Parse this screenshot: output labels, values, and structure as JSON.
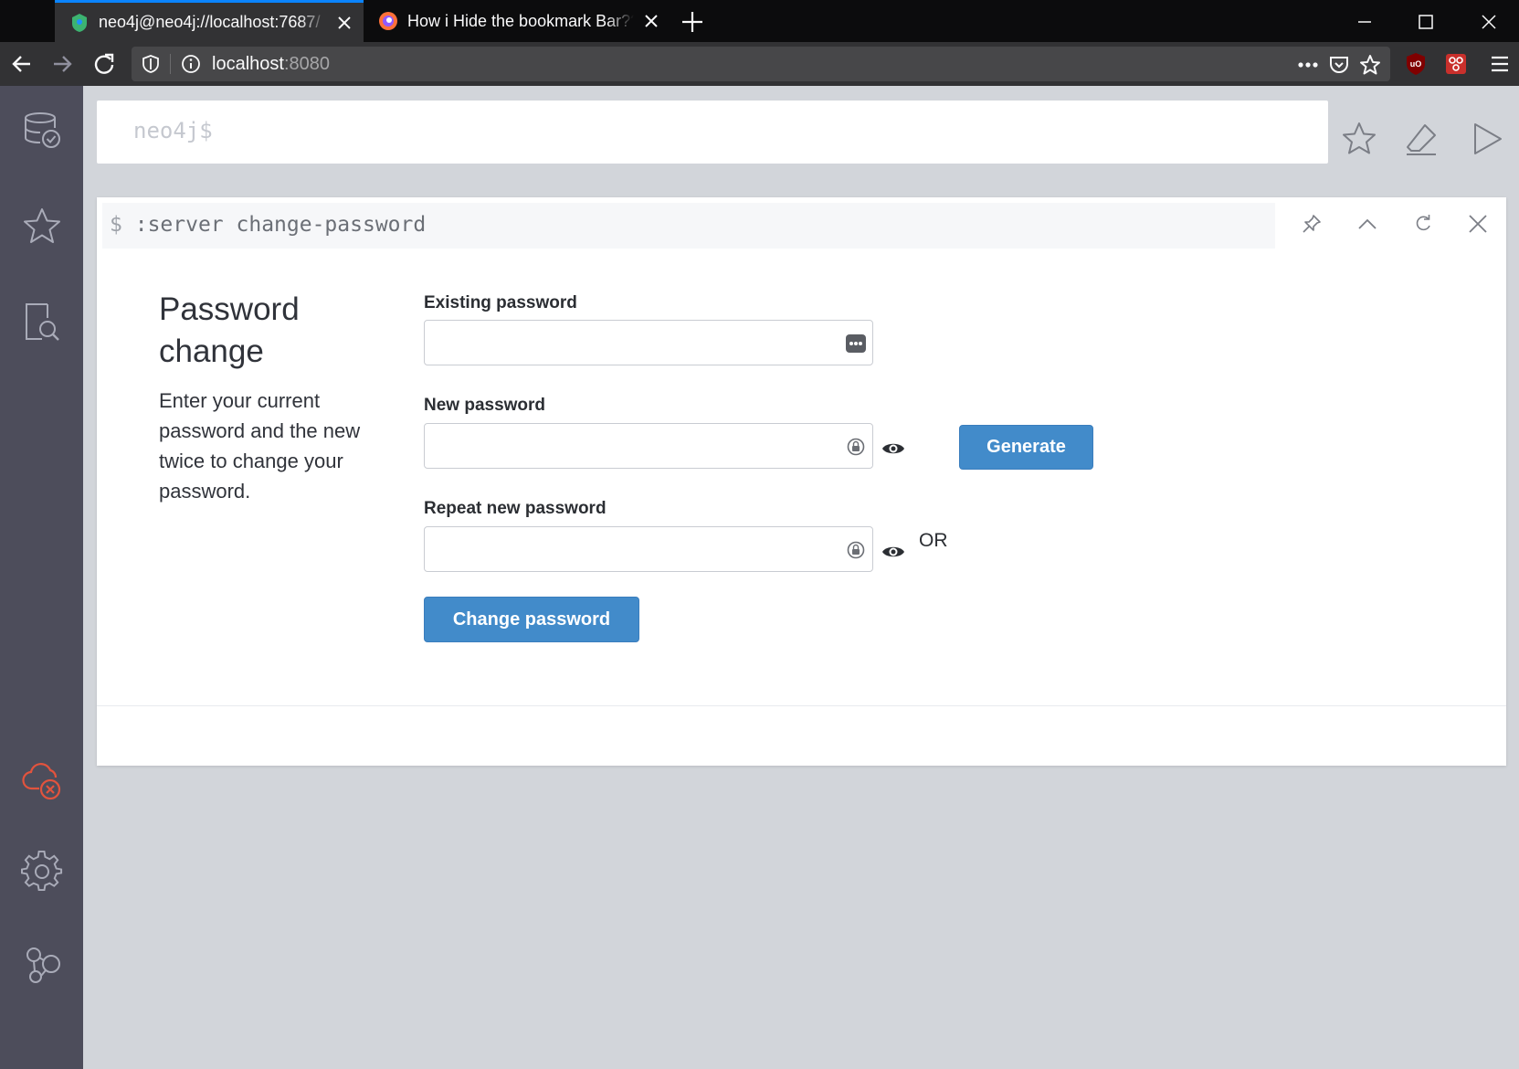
{
  "browser": {
    "tabs": [
      {
        "title": "neo4j@neo4j://localhost:7687/",
        "active": true,
        "favicon": "neo4j-icon"
      },
      {
        "title": "How i Hide the bookmark Bar??",
        "active": false,
        "favicon": "firefox-icon"
      }
    ],
    "url_host": "localhost",
    "url_port": ":8080"
  },
  "editor": {
    "prompt": "neo4j$"
  },
  "frame": {
    "dollar": "$",
    "command": ":server change-password"
  },
  "password_change": {
    "title": "Password change",
    "description": "Enter your current password and the new twice to change your password.",
    "existing_label": "Existing password",
    "new_label": "New password",
    "repeat_label": "Repeat new password",
    "or_label": "OR",
    "generate_label": "Generate",
    "submit_label": "Change password"
  },
  "colors": {
    "accent": "#428bca",
    "sidebar": "#4d4d5b",
    "disconnected": "#e2533d"
  }
}
